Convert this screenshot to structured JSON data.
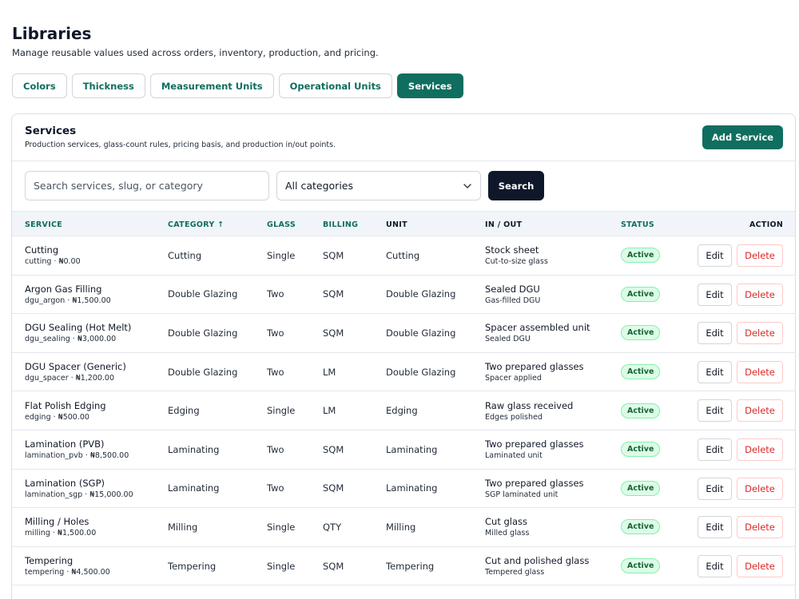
{
  "page": {
    "title": "Libraries",
    "subtitle": "Manage reusable values used across orders, inventory, production, and pricing."
  },
  "tabs": [
    {
      "label": "Colors",
      "active": false
    },
    {
      "label": "Thickness",
      "active": false
    },
    {
      "label": "Measurement Units",
      "active": false
    },
    {
      "label": "Operational Units",
      "active": false
    },
    {
      "label": "Services",
      "active": true
    }
  ],
  "card": {
    "title": "Services",
    "description": "Production services, glass-count rules, pricing basis, and production in/out points.",
    "add_button": "Add Service"
  },
  "filters": {
    "search_placeholder": "Search services, slug, or category",
    "search_value": "",
    "category_selected": "All categories",
    "search_button": "Search"
  },
  "table": {
    "headers": {
      "service": "SERVICE",
      "category": "CATEGORY ↑",
      "glass": "GLASS",
      "billing": "BILLING",
      "unit": "UNIT",
      "inout": "IN / OUT",
      "status": "STATUS",
      "action": "ACTION"
    },
    "rows": [
      {
        "name": "Cutting",
        "meta": "cutting · ₦0.00",
        "category": "Cutting",
        "glass": "Single",
        "billing": "SQM",
        "unit": "Cutting",
        "in": "Stock sheet",
        "out": "Cut-to-size glass",
        "status": "Active",
        "edit": "Edit",
        "delete": "Delete"
      },
      {
        "name": "Argon Gas Filling",
        "meta": "dgu_argon · ₦1,500.00",
        "category": "Double Glazing",
        "glass": "Two",
        "billing": "SQM",
        "unit": "Double Glazing",
        "in": "Sealed DGU",
        "out": "Gas-filled DGU",
        "status": "Active",
        "edit": "Edit",
        "delete": "Delete"
      },
      {
        "name": "DGU Sealing (Hot Melt)",
        "meta": "dgu_sealing · ₦3,000.00",
        "category": "Double Glazing",
        "glass": "Two",
        "billing": "SQM",
        "unit": "Double Glazing",
        "in": "Spacer assembled unit",
        "out": "Sealed DGU",
        "status": "Active",
        "edit": "Edit",
        "delete": "Delete"
      },
      {
        "name": "DGU Spacer (Generic)",
        "meta": "dgu_spacer · ₦1,200.00",
        "category": "Double Glazing",
        "glass": "Two",
        "billing": "LM",
        "unit": "Double Glazing",
        "in": "Two prepared glasses",
        "out": "Spacer applied",
        "status": "Active",
        "edit": "Edit",
        "delete": "Delete"
      },
      {
        "name": "Flat Polish Edging",
        "meta": "edging · ₦500.00",
        "category": "Edging",
        "glass": "Single",
        "billing": "LM",
        "unit": "Edging",
        "in": "Raw glass received",
        "out": "Edges polished",
        "status": "Active",
        "edit": "Edit",
        "delete": "Delete"
      },
      {
        "name": "Lamination (PVB)",
        "meta": "lamination_pvb · ₦8,500.00",
        "category": "Laminating",
        "glass": "Two",
        "billing": "SQM",
        "unit": "Laminating",
        "in": "Two prepared glasses",
        "out": "Laminated unit",
        "status": "Active",
        "edit": "Edit",
        "delete": "Delete"
      },
      {
        "name": "Lamination (SGP)",
        "meta": "lamination_sgp · ₦15,000.00",
        "category": "Laminating",
        "glass": "Two",
        "billing": "SQM",
        "unit": "Laminating",
        "in": "Two prepared glasses",
        "out": "SGP laminated unit",
        "status": "Active",
        "edit": "Edit",
        "delete": "Delete"
      },
      {
        "name": "Milling / Holes",
        "meta": "milling · ₦1,500.00",
        "category": "Milling",
        "glass": "Single",
        "billing": "QTY",
        "unit": "Milling",
        "in": "Cut glass",
        "out": "Milled glass",
        "status": "Active",
        "edit": "Edit",
        "delete": "Delete"
      },
      {
        "name": "Tempering",
        "meta": "tempering · ₦4,500.00",
        "category": "Tempering",
        "glass": "Single",
        "billing": "SQM",
        "unit": "Tempering",
        "in": "Cut and polished glass",
        "out": "Tempered glass",
        "status": "Active",
        "edit": "Edit",
        "delete": "Delete"
      }
    ]
  },
  "icons": {
    "select_arrow": "chevron-down-icon"
  },
  "colors": {
    "accent": "#0f6e5f",
    "dark_button": "#0f172a",
    "active_badge": "#dcfce7",
    "delete": "#dc2626"
  }
}
